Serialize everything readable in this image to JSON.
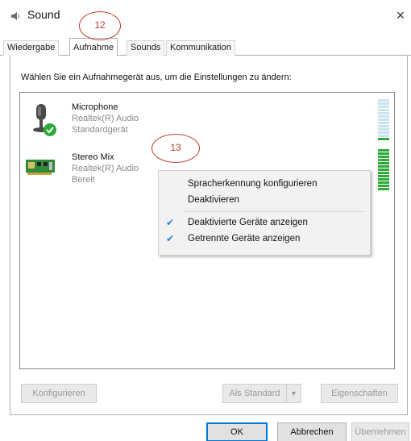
{
  "window": {
    "title": "Sound",
    "close_glyph": "×"
  },
  "tabs": [
    {
      "label": "Wiedergabe",
      "active": false
    },
    {
      "label": "Aufnahme",
      "active": true
    },
    {
      "label": "Sounds",
      "active": false
    },
    {
      "label": "Kommunikation",
      "active": false
    }
  ],
  "instruction": "Wählen Sie ein Aufnahmegerät aus, um die Einstellungen zu ändern:",
  "devices": [
    {
      "name": "Microphone",
      "driver": "Realtek(R) Audio",
      "status": "Standardgerät",
      "icon": "microphone-icon",
      "level_fraction": 0.1
    },
    {
      "name": "Stereo Mix",
      "driver": "Realtek(R) Audio",
      "status": "Bereit",
      "icon": "sound-card-icon",
      "level_fraction": 1.0
    }
  ],
  "context_menu": {
    "items": [
      {
        "label": "Spracherkennung konfigurieren",
        "checked": false
      },
      {
        "label": "Deaktivieren",
        "checked": false
      },
      {
        "label": "Deaktivierte Geräte anzeigen",
        "checked": true
      },
      {
        "label": "Getrennte Geräte anzeigen",
        "checked": true
      }
    ]
  },
  "annotations": {
    "tab_marker": "12",
    "list_marker": "13"
  },
  "buttons": {
    "configure": "Konfigurieren",
    "set_default": "Als Standard",
    "properties": "Eigenschaften",
    "ok": "OK",
    "cancel": "Abbrechen",
    "apply": "Übernehmen"
  },
  "colors": {
    "accent": "#0078d7",
    "annotation": "#c0392b",
    "meter_green": "#2eaa3a",
    "check_blue": "#2a7fd4"
  }
}
